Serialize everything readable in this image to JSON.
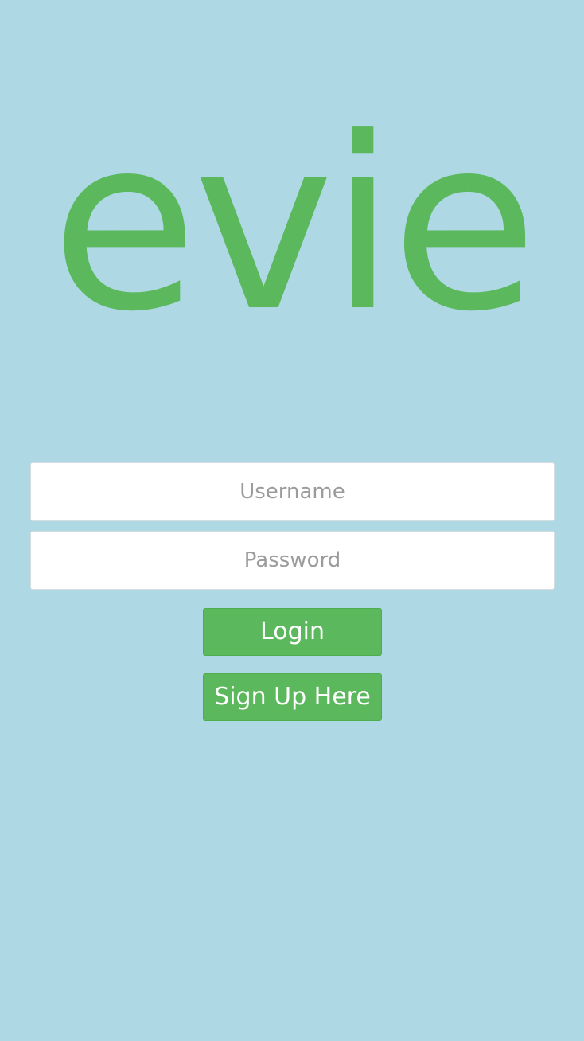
{
  "brand": {
    "logo_text": "evie",
    "color": "#5cb85c"
  },
  "background_color": "#add8e4",
  "form": {
    "username": {
      "value": "",
      "placeholder": "Username"
    },
    "password": {
      "value": "",
      "placeholder": "Password"
    },
    "login_label": "Login",
    "signup_label": "Sign Up Here",
    "button_color": "#5cb85c"
  }
}
